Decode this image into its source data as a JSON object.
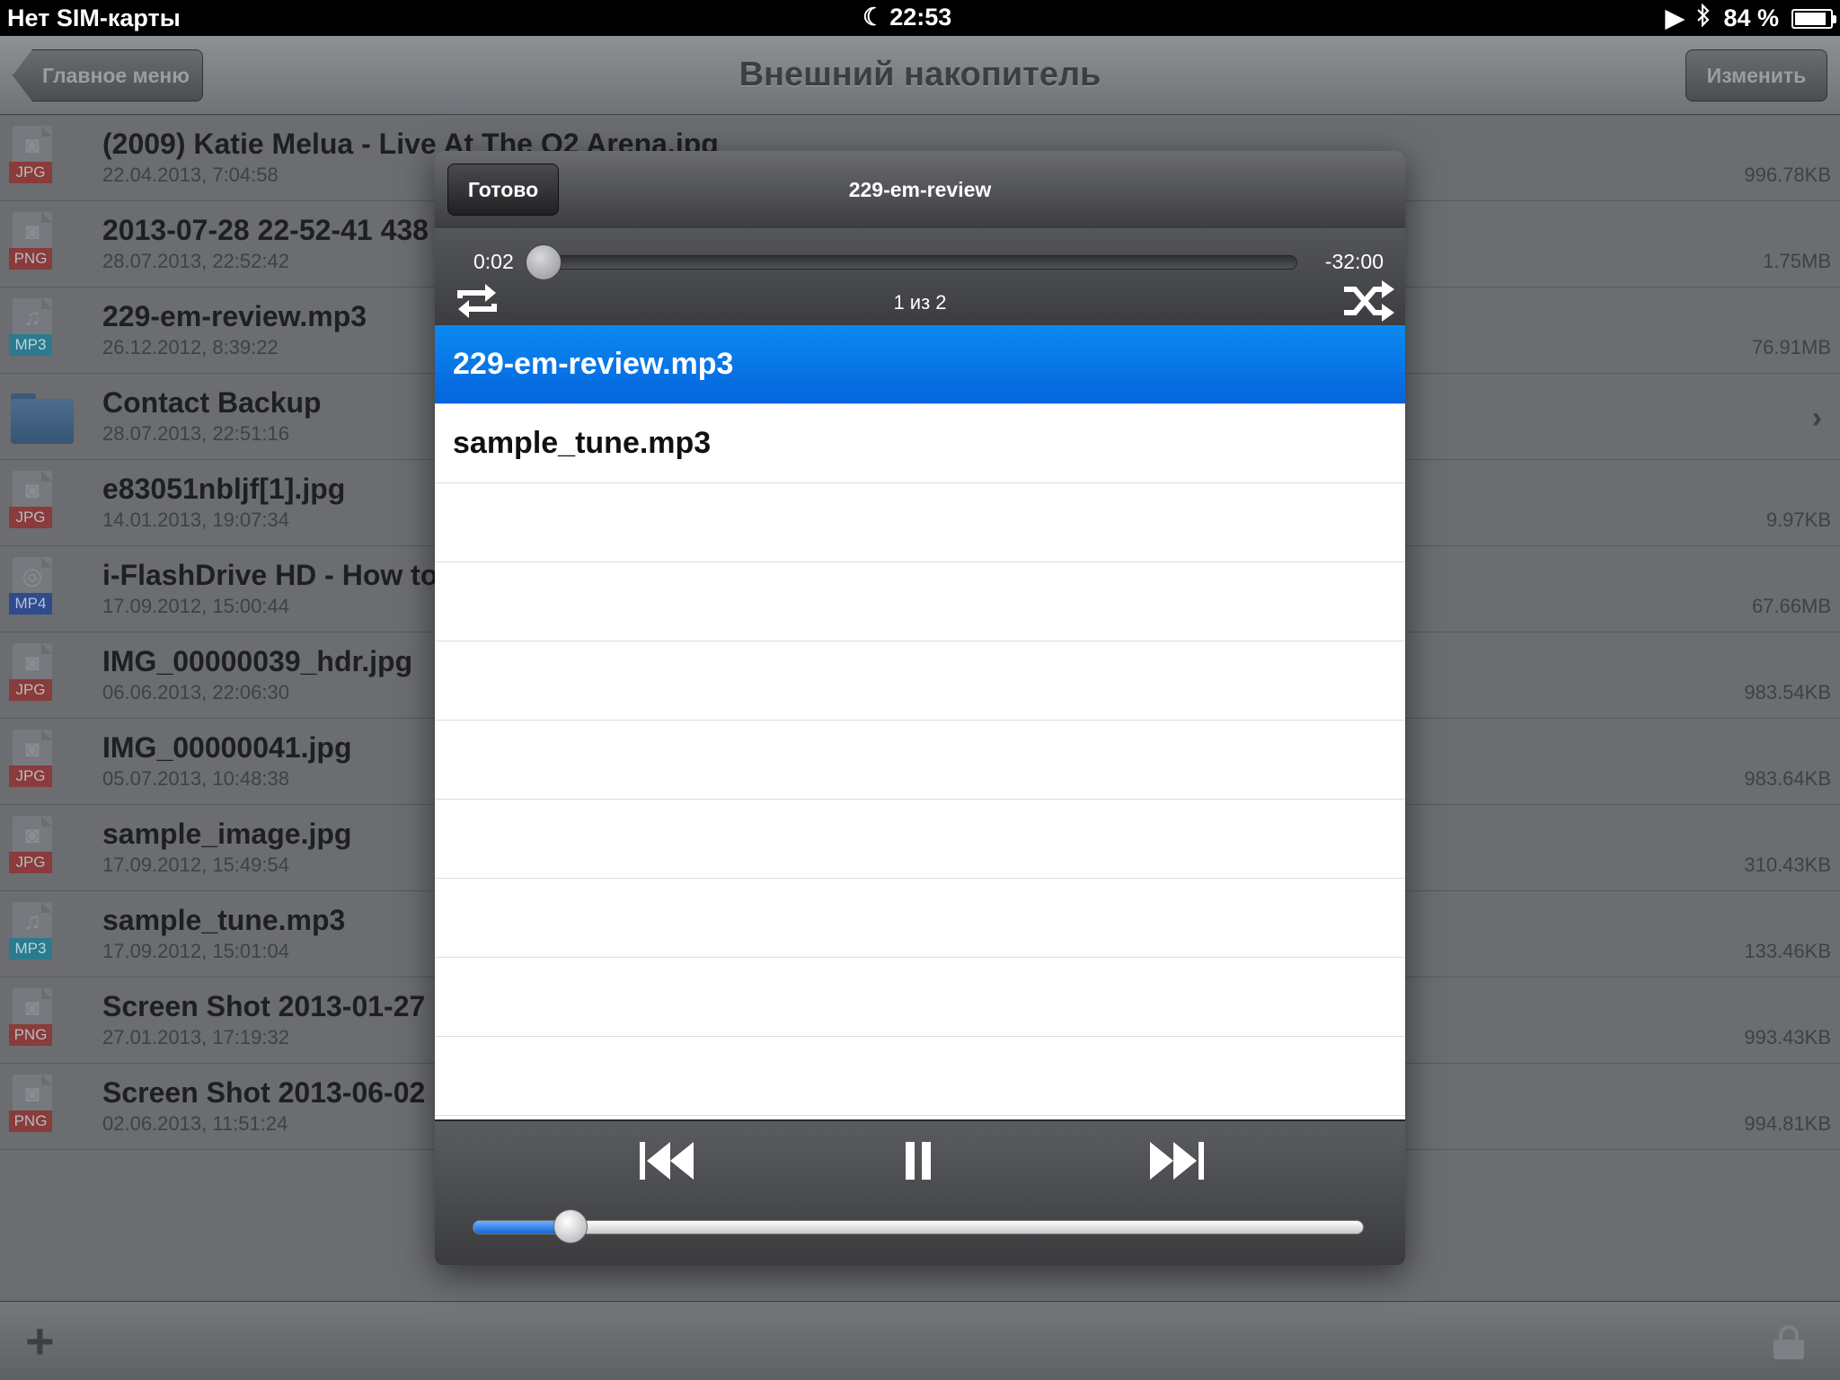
{
  "status_bar": {
    "carrier": "Нет SIM-карты",
    "time": "22:53",
    "battery": "84 %",
    "battery_level": 0.84
  },
  "nav": {
    "back_label": "Главное меню",
    "title": "Внешний накопитель",
    "edit_label": "Изменить"
  },
  "files": [
    {
      "name": "(2009) Katie Melua  - Live At The O2 Arena.jpg",
      "date": "22.04.2013, 7:04:58",
      "size": "996.78KB",
      "type": "JPG"
    },
    {
      "name": "2013-07-28 22-52-41 438",
      "date": "28.07.2013, 22:52:42",
      "size": "1.75MB",
      "type": "PNG"
    },
    {
      "name": "229-em-review.mp3",
      "date": "26.12.2012, 8:39:22",
      "size": "76.91MB",
      "type": "MP3"
    },
    {
      "name": "Contact Backup",
      "date": "28.07.2013, 22:51:16",
      "size": "",
      "type": "folder"
    },
    {
      "name": "e83051nbljf[1].jpg",
      "date": "14.01.2013, 19:07:34",
      "size": "9.97KB",
      "type": "JPG"
    },
    {
      "name": "i-FlashDrive HD - How to",
      "date": "17.09.2012, 15:00:44",
      "size": "67.66MB",
      "type": "MP4"
    },
    {
      "name": "IMG_00000039_hdr.jpg",
      "date": "06.06.2013, 22:06:30",
      "size": "983.54KB",
      "type": "JPG"
    },
    {
      "name": "IMG_00000041.jpg",
      "date": "05.07.2013, 10:48:38",
      "size": "983.64KB",
      "type": "JPG"
    },
    {
      "name": "sample_image.jpg",
      "date": "17.09.2012, 15:49:54",
      "size": "310.43KB",
      "type": "JPG"
    },
    {
      "name": "sample_tune.mp3",
      "date": "17.09.2012, 15:01:04",
      "size": "133.46KB",
      "type": "MP3"
    },
    {
      "name": "Screen Shot 2013-01-27",
      "date": "27.01.2013, 17:19:32",
      "size": "993.43KB",
      "type": "PNG"
    },
    {
      "name": "Screen Shot 2013-06-02",
      "date": "02.06.2013, 11:51:24",
      "size": "994.81KB",
      "type": "PNG"
    }
  ],
  "player": {
    "done_label": "Готово",
    "title": "229-em-review",
    "elapsed": "0:02",
    "remaining": "-32:00",
    "track_counter": "1 из 2",
    "progress": 0.001,
    "volume": 0.11,
    "playlist": [
      {
        "label": "229-em-review.mp3",
        "selected": true
      },
      {
        "label": "sample_tune.mp3",
        "selected": false
      }
    ]
  },
  "colors": {
    "selection_blue": "#0664dd",
    "badge_jpg": "#8a3b3b",
    "badge_mp3": "#2b7a8e",
    "badge_mp4": "#2f4b8b"
  }
}
